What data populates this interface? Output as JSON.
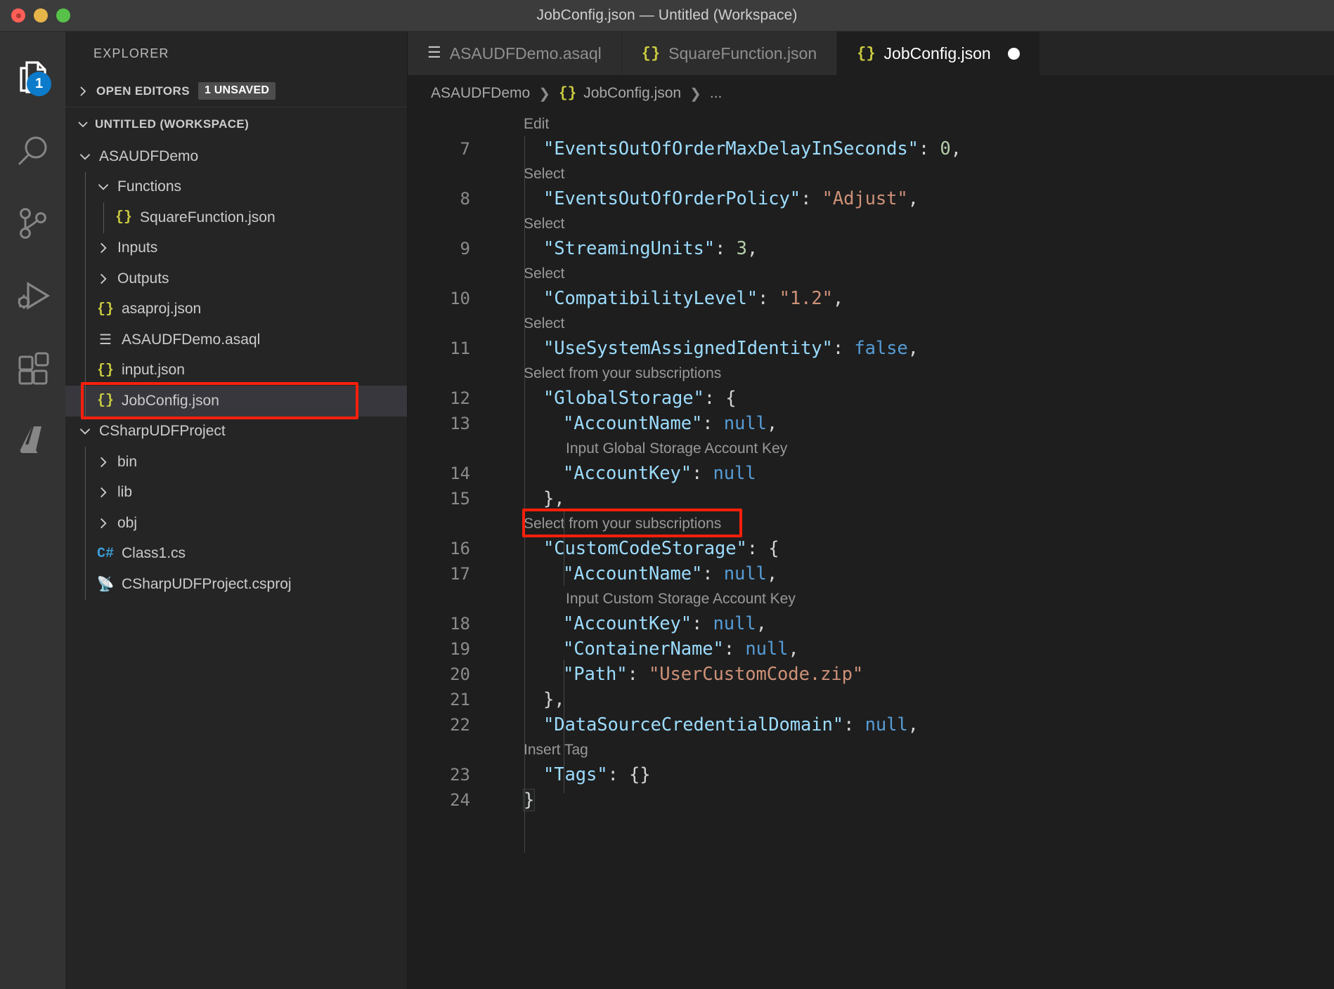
{
  "window": {
    "title": "JobConfig.json — Untitled (Workspace)",
    "traffic_lights": [
      "close-red",
      "minimize-yellow",
      "maximize-green"
    ]
  },
  "activity_bar": {
    "items": [
      {
        "name": "explorer-icon",
        "label": "Explorer",
        "badge": "1",
        "active": true
      },
      {
        "name": "search-icon",
        "label": "Search",
        "badge": "",
        "active": false
      },
      {
        "name": "source-control-icon",
        "label": "Source Control",
        "badge": "",
        "active": false
      },
      {
        "name": "run-debug-icon",
        "label": "Run and Debug",
        "badge": "",
        "active": false
      },
      {
        "name": "extensions-icon",
        "label": "Extensions",
        "badge": "",
        "active": false
      },
      {
        "name": "azure-icon",
        "label": "Azure",
        "badge": "",
        "active": false
      }
    ]
  },
  "sidebar": {
    "title": "EXPLORER",
    "open_editors": {
      "label": "OPEN EDITORS",
      "badge": "1 UNSAVED",
      "expanded": false
    },
    "workspace": {
      "label": "UNTITLED (WORKSPACE)",
      "expanded": true
    },
    "tree": [
      {
        "label": "ASAUDFDemo",
        "depth": 1,
        "type": "folder",
        "expanded": true,
        "icon": ""
      },
      {
        "label": "Functions",
        "depth": 2,
        "type": "folder",
        "expanded": true,
        "icon": ""
      },
      {
        "label": "SquareFunction.json",
        "depth": 3,
        "type": "file",
        "icon": "json"
      },
      {
        "label": "Inputs",
        "depth": 2,
        "type": "folder",
        "expanded": false,
        "icon": ""
      },
      {
        "label": "Outputs",
        "depth": 2,
        "type": "folder",
        "expanded": false,
        "icon": ""
      },
      {
        "label": "asaproj.json",
        "depth": 2,
        "type": "file",
        "icon": "json"
      },
      {
        "label": "ASAUDFDemo.asaql",
        "depth": 2,
        "type": "file",
        "icon": "asaql"
      },
      {
        "label": "input.json",
        "depth": 2,
        "type": "file",
        "icon": "json"
      },
      {
        "label": "JobConfig.json",
        "depth": 2,
        "type": "file",
        "icon": "json",
        "selected": true,
        "highlighted": true
      },
      {
        "label": "CSharpUDFProject",
        "depth": 1,
        "type": "folder",
        "expanded": true,
        "icon": ""
      },
      {
        "label": "bin",
        "depth": 2,
        "type": "folder",
        "expanded": false,
        "icon": ""
      },
      {
        "label": "lib",
        "depth": 2,
        "type": "folder",
        "expanded": false,
        "icon": ""
      },
      {
        "label": "obj",
        "depth": 2,
        "type": "folder",
        "expanded": false,
        "icon": ""
      },
      {
        "label": "Class1.cs",
        "depth": 2,
        "type": "file",
        "icon": "cs"
      },
      {
        "label": "CSharpUDFProject.csproj",
        "depth": 2,
        "type": "file",
        "icon": "csproj"
      }
    ]
  },
  "tabs": [
    {
      "label": "ASAUDFDemo.asaql",
      "icon": "asaql",
      "active": false,
      "dirty": false
    },
    {
      "label": "SquareFunction.json",
      "icon": "json",
      "active": false,
      "dirty": false
    },
    {
      "label": "JobConfig.json",
      "icon": "json",
      "active": true,
      "dirty": true
    }
  ],
  "breadcrumb": {
    "items": [
      "ASAUDFDemo",
      "JobConfig.json",
      "..."
    ],
    "icon": "{}"
  },
  "editor": {
    "first_visible_lens": "Edit",
    "lines": [
      {
        "lens": "Edit",
        "num": "7",
        "indent": 1,
        "tokens": [
          {
            "t": "\"EventsOutOfOrderMaxDelayInSeconds\"",
            "c": "k"
          },
          {
            "t": ": ",
            "c": "p"
          },
          {
            "t": "0",
            "c": "n"
          },
          {
            "t": ",",
            "c": "p"
          }
        ]
      },
      {
        "lens": "Select",
        "num": "8",
        "indent": 1,
        "tokens": [
          {
            "t": "\"EventsOutOfOrderPolicy\"",
            "c": "k"
          },
          {
            "t": ": ",
            "c": "p"
          },
          {
            "t": "\"Adjust\"",
            "c": "s"
          },
          {
            "t": ",",
            "c": "p"
          }
        ]
      },
      {
        "lens": "Select",
        "num": "9",
        "indent": 1,
        "tokens": [
          {
            "t": "\"StreamingUnits\"",
            "c": "k"
          },
          {
            "t": ": ",
            "c": "p"
          },
          {
            "t": "3",
            "c": "n"
          },
          {
            "t": ",",
            "c": "p"
          }
        ]
      },
      {
        "lens": "Select",
        "num": "10",
        "indent": 1,
        "tokens": [
          {
            "t": "\"CompatibilityLevel\"",
            "c": "k"
          },
          {
            "t": ": ",
            "c": "p"
          },
          {
            "t": "\"1.2\"",
            "c": "s"
          },
          {
            "t": ",",
            "c": "p"
          }
        ]
      },
      {
        "lens": "Select",
        "num": "11",
        "indent": 1,
        "tokens": [
          {
            "t": "\"UseSystemAssignedIdentity\"",
            "c": "k"
          },
          {
            "t": ": ",
            "c": "p"
          },
          {
            "t": "false",
            "c": "b"
          },
          {
            "t": ",",
            "c": "p"
          }
        ]
      },
      {
        "lens": "Select from your subscriptions",
        "num": "12",
        "indent": 1,
        "tokens": [
          {
            "t": "\"GlobalStorage\"",
            "c": "k"
          },
          {
            "t": ": {",
            "c": "p"
          }
        ]
      },
      {
        "lens": "",
        "num": "13",
        "indent": 2,
        "tokens": [
          {
            "t": "\"AccountName\"",
            "c": "k"
          },
          {
            "t": ": ",
            "c": "p"
          },
          {
            "t": "null",
            "c": "b"
          },
          {
            "t": ",",
            "c": "p"
          }
        ]
      },
      {
        "lens": "Input Global Storage Account Key",
        "lens_indent": 2,
        "num": "14",
        "indent": 2,
        "tokens": [
          {
            "t": "\"AccountKey\"",
            "c": "k"
          },
          {
            "t": ": ",
            "c": "p"
          },
          {
            "t": "null",
            "c": "b"
          }
        ]
      },
      {
        "lens": "",
        "num": "15",
        "indent": 1,
        "tokens": [
          {
            "t": "},",
            "c": "p"
          }
        ]
      },
      {
        "lens": "Select from your subscriptions",
        "lens_highlight": true,
        "num": "16",
        "indent": 1,
        "tokens": [
          {
            "t": "\"CustomCodeStorage\"",
            "c": "k"
          },
          {
            "t": ": {",
            "c": "p"
          }
        ]
      },
      {
        "lens": "",
        "num": "17",
        "indent": 2,
        "tokens": [
          {
            "t": "\"AccountName\"",
            "c": "k"
          },
          {
            "t": ": ",
            "c": "p"
          },
          {
            "t": "null",
            "c": "b"
          },
          {
            "t": ",",
            "c": "p"
          }
        ]
      },
      {
        "lens": "Input Custom Storage Account Key",
        "lens_indent": 2,
        "num": "18",
        "indent": 2,
        "tokens": [
          {
            "t": "\"AccountKey\"",
            "c": "k"
          },
          {
            "t": ": ",
            "c": "p"
          },
          {
            "t": "null",
            "c": "b"
          },
          {
            "t": ",",
            "c": "p"
          }
        ]
      },
      {
        "lens": "",
        "num": "19",
        "indent": 2,
        "tokens": [
          {
            "t": "\"ContainerName\"",
            "c": "k"
          },
          {
            "t": ": ",
            "c": "p"
          },
          {
            "t": "null",
            "c": "b"
          },
          {
            "t": ",",
            "c": "p"
          }
        ]
      },
      {
        "lens": "",
        "num": "20",
        "indent": 2,
        "tokens": [
          {
            "t": "\"Path\"",
            "c": "k"
          },
          {
            "t": ": ",
            "c": "p"
          },
          {
            "t": "\"UserCustomCode.zip\"",
            "c": "s"
          }
        ]
      },
      {
        "lens": "",
        "num": "21",
        "indent": 1,
        "tokens": [
          {
            "t": "},",
            "c": "p"
          }
        ]
      },
      {
        "lens": "",
        "num": "22",
        "indent": 1,
        "tokens": [
          {
            "t": "\"DataSourceCredentialDomain\"",
            "c": "k"
          },
          {
            "t": ": ",
            "c": "p"
          },
          {
            "t": "null",
            "c": "b"
          },
          {
            "t": ",",
            "c": "p"
          }
        ]
      },
      {
        "lens": "Insert Tag",
        "num": "23",
        "indent": 1,
        "tokens": [
          {
            "t": "\"Tags\"",
            "c": "k"
          },
          {
            "t": ": {}",
            "c": "p"
          }
        ]
      },
      {
        "lens": "",
        "num": "24",
        "indent": 0,
        "tokens": [
          {
            "t": "}",
            "c": "p",
            "cursor": true
          }
        ]
      }
    ]
  },
  "colors": {
    "accent_red_highlight": "#fb1f0b",
    "badge_blue": "#0c7bcb",
    "json_icon_yellow": "#cbcb41",
    "cs_icon_blue": "#3b9fd6",
    "csproj_icon_orange": "#e37933",
    "key_blue": "#9cdcfe",
    "string_orange": "#ce9178",
    "number_green": "#b5cea8",
    "keyword_blue": "#569cd6",
    "titlebar_bg": "#3c3c3c",
    "sidebar_bg": "#252526",
    "editor_bg": "#1e1e1e",
    "activitybar_bg": "#333333"
  }
}
